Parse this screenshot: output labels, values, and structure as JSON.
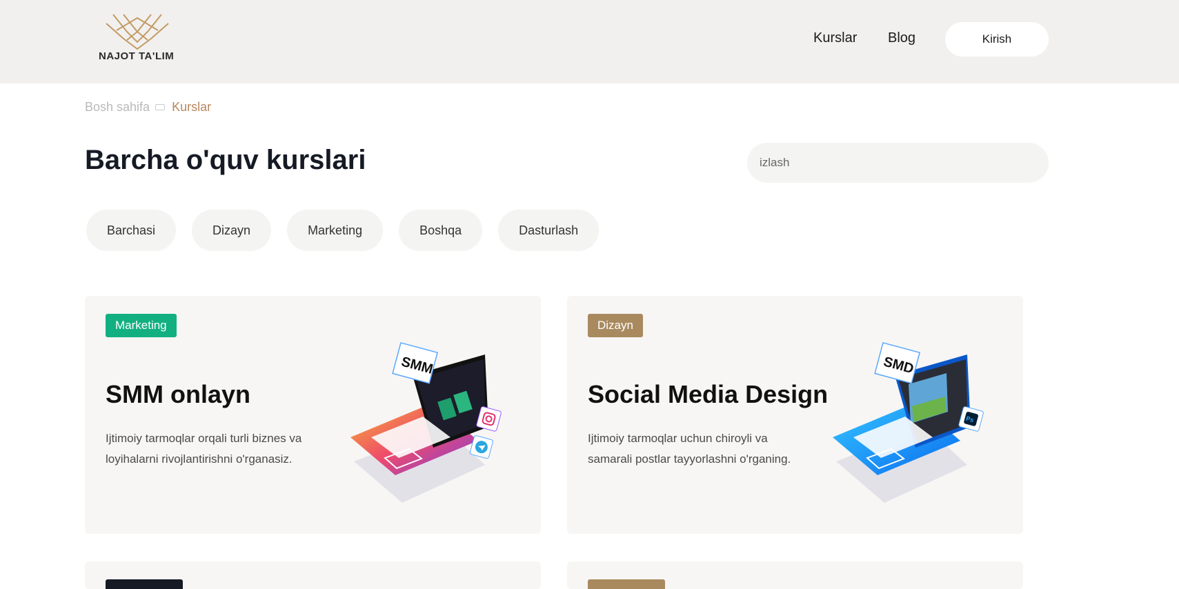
{
  "header": {
    "logo_text": "NAJOT TA'LIM",
    "nav": {
      "courses": "Kurslar",
      "blog": "Blog"
    },
    "login_label": "Kirish"
  },
  "breadcrumb": {
    "home": "Bosh sahifa",
    "current": "Kurslar"
  },
  "page_title": "Barcha o'quv kurslari",
  "search": {
    "placeholder": "izlash",
    "value": ""
  },
  "filters": [
    "Barchasi",
    "Dizayn",
    "Marketing",
    "Boshqa",
    "Dasturlash"
  ],
  "courses": [
    {
      "tag": "Marketing",
      "tag_color": "#12b081",
      "title": "SMM onlayn",
      "description": "Ijtimoiy tarmoqlar orqali turli biznes va loyihalarni rivojlantirishni o'rganasiz.",
      "badge_text": "SMM",
      "icons": [
        "instagram-icon",
        "telegram-icon"
      ]
    },
    {
      "tag": "Dizayn",
      "tag_color": "#a98a5f",
      "title": "Social Media Design",
      "description": "Ijtimoiy tarmoqlar uchun chiroyli va samarali postlar tayyorlashni o'rganing.",
      "badge_text": "SMD",
      "icons": [
        "photoshop-icon"
      ]
    }
  ],
  "partial_cards": [
    {
      "tag_color": "#151a24"
    },
    {
      "tag_color": "#a98a5f"
    }
  ],
  "colors": {
    "header_bg": "#f1f0ee",
    "accent": "#b8865b",
    "card_bg": "#f7f6f4"
  }
}
